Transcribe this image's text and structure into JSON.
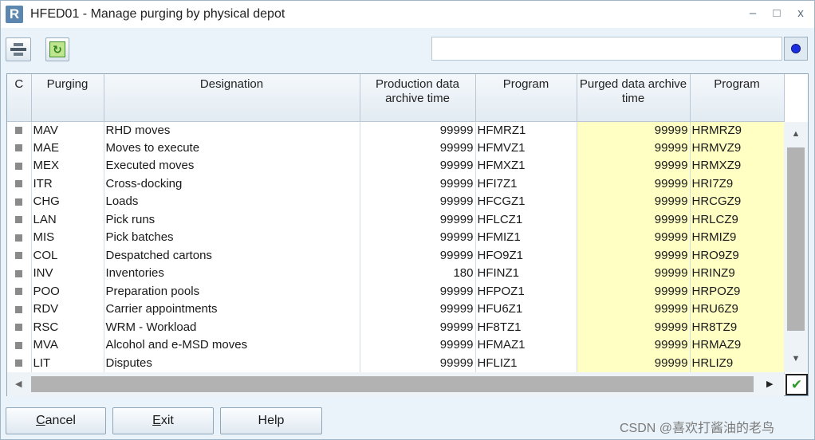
{
  "window": {
    "logo_letter": "R",
    "title": "HFED01 - Manage purging by physical depot",
    "controls": [
      "–",
      "□",
      "x"
    ]
  },
  "toolbar": {
    "print_icon": "printer-icon",
    "refresh_icon": "refresh-icon",
    "refresh_glyph": "↻",
    "status_dot_color": "#1a2ee0"
  },
  "grid": {
    "columns": [
      "C",
      "Purging",
      "Designation",
      "Production data archive time",
      "Program",
      "Purged data archive time",
      "Program"
    ],
    "rows": [
      {
        "code": "MAV",
        "designation": "RHD moves",
        "prod_time": "99999",
        "prod_program": "HFMRZ1",
        "purged_time": "99999",
        "purged_program": "HRMRZ9"
      },
      {
        "code": "MAE",
        "designation": "Moves to execute",
        "prod_time": "99999",
        "prod_program": "HFMVZ1",
        "purged_time": "99999",
        "purged_program": "HRMVZ9"
      },
      {
        "code": "MEX",
        "designation": "Executed moves",
        "prod_time": "99999",
        "prod_program": "HFMXZ1",
        "purged_time": "99999",
        "purged_program": "HRMXZ9"
      },
      {
        "code": "ITR",
        "designation": "Cross-docking",
        "prod_time": "99999",
        "prod_program": "HFI7Z1",
        "purged_time": "99999",
        "purged_program": "HRI7Z9"
      },
      {
        "code": "CHG",
        "designation": "Loads",
        "prod_time": "99999",
        "prod_program": "HFCGZ1",
        "purged_time": "99999",
        "purged_program": "HRCGZ9"
      },
      {
        "code": "LAN",
        "designation": "Pick runs",
        "prod_time": "99999",
        "prod_program": "HFLCZ1",
        "purged_time": "99999",
        "purged_program": "HRLCZ9"
      },
      {
        "code": "MIS",
        "designation": "Pick batches",
        "prod_time": "99999",
        "prod_program": "HFMIZ1",
        "purged_time": "99999",
        "purged_program": "HRMIZ9"
      },
      {
        "code": "COL",
        "designation": "Despatched cartons",
        "prod_time": "99999",
        "prod_program": "HFO9Z1",
        "purged_time": "99999",
        "purged_program": "HRO9Z9"
      },
      {
        "code": "INV",
        "designation": "Inventories",
        "prod_time": "180",
        "prod_program": "HFINZ1",
        "purged_time": "99999",
        "purged_program": "HRINZ9"
      },
      {
        "code": "POO",
        "designation": "Preparation pools",
        "prod_time": "99999",
        "prod_program": "HFPOZ1",
        "purged_time": "99999",
        "purged_program": "HRPOZ9"
      },
      {
        "code": "RDV",
        "designation": "Carrier appointments",
        "prod_time": "99999",
        "prod_program": "HFU6Z1",
        "purged_time": "99999",
        "purged_program": "HRU6Z9"
      },
      {
        "code": "RSC",
        "designation": "WRM - Workload",
        "prod_time": "99999",
        "prod_program": "HF8TZ1",
        "purged_time": "99999",
        "purged_program": "HR8TZ9"
      },
      {
        "code": "MVA",
        "designation": "Alcohol and e-MSD moves",
        "prod_time": "99999",
        "prod_program": "HFMAZ1",
        "purged_time": "99999",
        "purged_program": "HRMAZ9"
      },
      {
        "code": "LIT",
        "designation": "Disputes",
        "prod_time": "99999",
        "prod_program": "HFLIZ1",
        "purged_time": "99999",
        "purged_program": "HRLIZ9"
      }
    ],
    "purged_column_color": "#ffffc4"
  },
  "scroll": {
    "up_glyph": "▲",
    "down_glyph": "▼",
    "left_glyph": "◀",
    "right_glyph": "▶"
  },
  "confirm_glyph": "✔",
  "buttons": {
    "cancel": {
      "first": "C",
      "rest": "ancel"
    },
    "exit": {
      "first": "E",
      "rest": "xit"
    },
    "help": "Help"
  },
  "watermark": "CSDN @喜欢打酱油的老鸟"
}
